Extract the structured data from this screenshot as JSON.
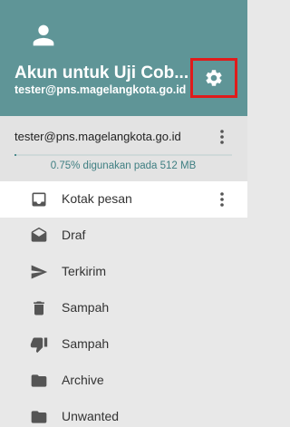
{
  "header": {
    "account_name": "Akun untuk Uji Cob...",
    "account_email": "tester@pns.magelangkota.go.id",
    "avatar_icon": "person-icon",
    "settings_icon": "gear-icon",
    "highlight_color": "#e01b1b",
    "background_color": "#5f9597"
  },
  "quota": {
    "email": "tester@pns.magelangkota.go.id",
    "usage_text": "0.75% digunakan pada 512 MB",
    "usage_fraction": 0.0075,
    "menu_icon": "more-vert-icon"
  },
  "folders": [
    {
      "label": "Kotak pesan",
      "icon": "inbox-icon",
      "active": true
    },
    {
      "label": "Draf",
      "icon": "drafts-icon",
      "active": false
    },
    {
      "label": "Terkirim",
      "icon": "send-icon",
      "active": false
    },
    {
      "label": "Sampah",
      "icon": "trash-icon",
      "active": false
    },
    {
      "label": "Sampah",
      "icon": "thumb-down-icon",
      "active": false
    },
    {
      "label": "Archive",
      "icon": "folder-icon",
      "active": false
    },
    {
      "label": "Unwanted",
      "icon": "folder-icon",
      "active": false
    }
  ]
}
